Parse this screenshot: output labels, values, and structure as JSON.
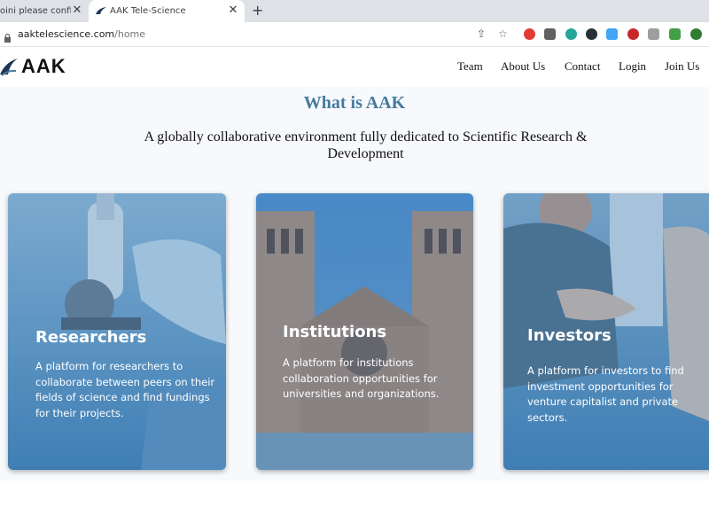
{
  "browser": {
    "tabs": [
      {
        "label": "oini please confirm"
      },
      {
        "label": "AAK Tele-Science"
      }
    ],
    "address": {
      "host": "aaktelescience.com",
      "path": "/home"
    }
  },
  "site": {
    "logo_text": "AAK",
    "nav": [
      "Team",
      "About Us",
      "Contact",
      "Login",
      "Join Us"
    ]
  },
  "hero": {
    "title": "What is AAK",
    "subtitle": "A globally collaborative environment fully dedicated to Scientific Research & Development"
  },
  "cards": [
    {
      "title": "Researchers",
      "text": "A platform for researchers to collaborate between peers on their fields of science and find fundings for their projects."
    },
    {
      "title": "Institutions",
      "text": "A platform for institutions collaboration opportunities for universities and organizations."
    },
    {
      "title": "Investors",
      "text": "A platform for investors to find investment opportunities for venture capitalist and private sectors."
    }
  ],
  "colors": {
    "accent": "#457b9d",
    "card_overlay": "#3f7fb5"
  }
}
